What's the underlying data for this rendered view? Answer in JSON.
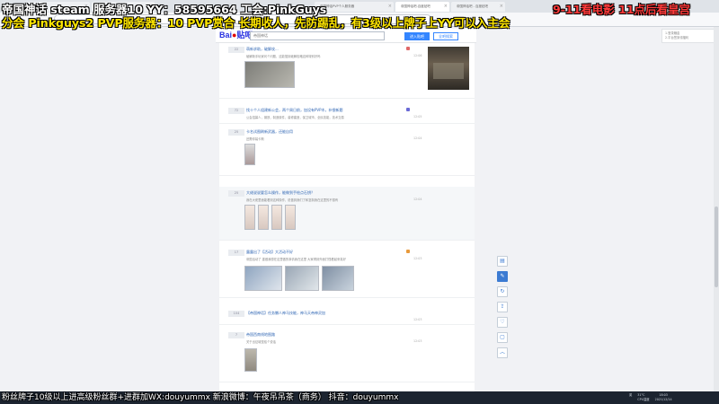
{
  "overlay": {
    "line1": "帝国神话 steam 服务器10   YY：58595664   工会:PinkGuys",
    "line2": "分会 Pinkguys2  PVP服务器：10 PVP赏合  长期收人，先防踢乱，有3级以上牌子上YY可以入主会",
    "schedule": "9-11看电影 11点后看皇宫",
    "ticker": "粉丝牌子10级以上进高级粉丝群+进群加WX:douyummx 新浪微博：午夜吊吊茶（商务）   抖音：douyummx"
  },
  "browser": {
    "tabs": [
      "百度贴吧",
      "帝国神话吧",
      "帝国神话PVP个人服务器",
      "帝国神话吧-百度贴吧",
      "帝国神话吧 - 百度贴吧"
    ]
  },
  "tieba": {
    "search_value": "帝国神话",
    "enter_button": "进入贴吧",
    "search_button": "全吧搜索",
    "threads": [
      {
        "count": "22",
        "title": "萌新求助，破解攻...",
        "preview": "破解新手玩家问个问题，这能搜到破解攻略这种特别好吗",
        "time": "12:06"
      },
      {
        "count": "72",
        "title": "找十个人组建新公会，两个周日前，加设有PVP木，补偿新题",
        "preview": "公会招募人，钢铁，制造原件，装修建造，保卫城市，全民技能，技术交易",
        "time": "12:05"
      },
      {
        "count": "25",
        "title": "卡名试图刷新武器，还能自用",
        "preview": "还需你装卡斯",
        "time": "12:04"
      },
      {
        "count": "25",
        "title": "大佬说说要怎么操作，能做到手绘点石钥？",
        "preview": "我在大佬里面能看到这种操作，说做到我们了和复制我在这里的不想有",
        "time": "12:04"
      },
      {
        "count": "17",
        "title": "露露出了【活动】大活动不好",
        "preview": "帝国活动了 重做我想在这里做的事情我在这里 大家得到外面打怪看起来真好",
        "time": "12:03"
      },
      {
        "count": "104",
        "title": "【帝国神话】任务懒人神马技能，神马天帝神灵加",
        "preview": "",
        "time": "12:03"
      },
      {
        "count": "7",
        "title": "帝国西南线地图路",
        "preview": "关于出征城堡给个说话",
        "time": "12:03"
      }
    ]
  },
  "notice": {
    "line1": "1.登录赚金",
    "line2": "2.平台签到领福利"
  },
  "tray": {
    "lang": "英",
    "cpu": "31°C",
    "cpu_label": "CPU温度",
    "clock_time": "18:03",
    "clock_date": "2021/12/14"
  },
  "colors": {
    "overlay_white": "#ffffff",
    "overlay_yellow": "#ffe600",
    "overlay_red": "#ff3a3a",
    "accent_blue": "#3385ff"
  }
}
